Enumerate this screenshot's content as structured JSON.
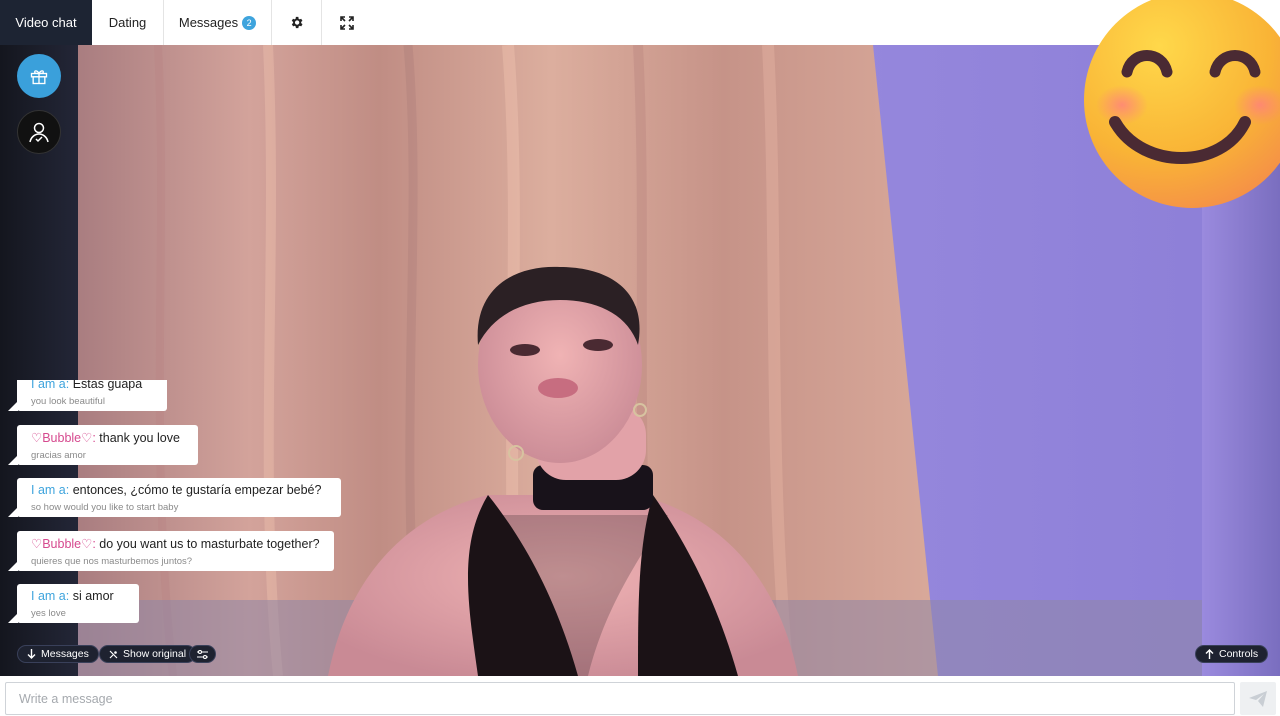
{
  "nav": {
    "tabs": [
      {
        "label": "Video chat"
      },
      {
        "label": "Dating"
      },
      {
        "label": "Messages",
        "badge": "2"
      }
    ],
    "settings_icon": "gear-icon",
    "fullscreen_icon": "expand-icon"
  },
  "sidebar": {
    "gift_icon": "gift-icon",
    "profile_icon": "user-icon"
  },
  "chat": {
    "messages": [
      {
        "author": "I am a:",
        "text": "Estas guapa",
        "translation": "you look beautiful",
        "self": true
      },
      {
        "author": "♡Bubble♡:",
        "text": "thank you love",
        "translation": "gracias amor",
        "self": false
      },
      {
        "author": "I am a:",
        "text": "entonces, ¿cómo te gustaría empezar bebé?",
        "translation": "so how would you like to start baby",
        "self": true
      },
      {
        "author": "♡Bubble♡:",
        "text": "do you want us to masturbate together?",
        "translation": "quieres que nos masturbemos juntos?",
        "self": false
      },
      {
        "author": "I am a:",
        "text": "si amor",
        "translation": "yes love",
        "self": true
      }
    ]
  },
  "controls": {
    "messages_label": "Messages",
    "show_original_label": "Show original",
    "controls_label": "Controls"
  },
  "composer": {
    "placeholder": "Write a message",
    "value": ""
  },
  "colors": {
    "accent": "#3ea4dd",
    "partner": "#d64a8f",
    "nav_active": "#1d2433"
  }
}
